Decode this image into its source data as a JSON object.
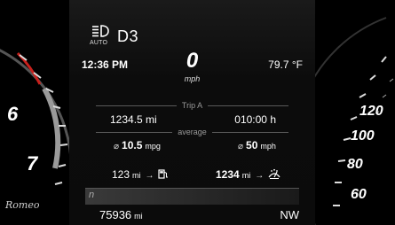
{
  "header": {
    "headlight_label": "AUTO",
    "gear": "D3"
  },
  "status": {
    "clock": "12:36 PM",
    "temperature": "79.7 °F"
  },
  "speed": {
    "value": "0",
    "unit": "mph"
  },
  "trip": {
    "title": "Trip A",
    "distance": "1234.5 mi",
    "time": "010:00 h",
    "average_label": "average",
    "avg_symbol": "⌀",
    "fuel_economy": "10.5",
    "fuel_economy_unit": "mpg",
    "avg_speed": "50",
    "avg_speed_unit": "mph"
  },
  "range": {
    "fuel_range": "123",
    "fuel_range_unit": "mi",
    "arrow": "→",
    "washer_range": "1234",
    "washer_range_unit": "mi"
  },
  "bottom": {
    "signal": "n",
    "odometer": "75936",
    "odometer_unit": "mi",
    "heading": "NW"
  },
  "tachometer": {
    "labels": [
      "6",
      "7"
    ],
    "brand": "Romeo"
  },
  "speedometer": {
    "labels": [
      "120",
      "100",
      "80",
      "60"
    ]
  },
  "colors": {
    "gauge_red": "#c8201c",
    "screen_bg": "#111111"
  }
}
